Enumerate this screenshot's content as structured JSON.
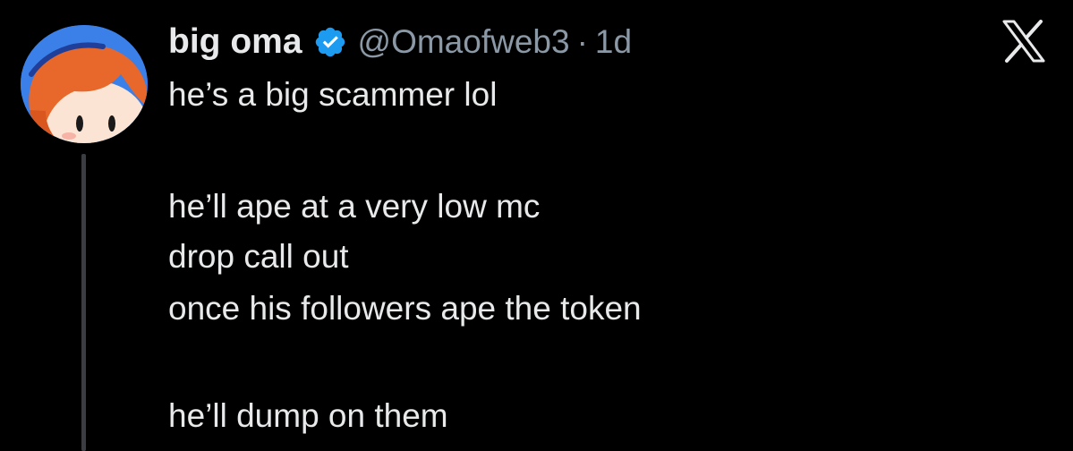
{
  "tweet": {
    "display_name": "big oma",
    "handle": "@Omaofweb3",
    "separator": "·",
    "time": "1d",
    "lines": [
      "he’s a big scammer lol",
      "he’ll ape at a very low mc",
      "drop call out",
      "once his followers ape the token",
      "he’ll dump on them"
    ]
  },
  "icons": {
    "verified": "verified-badge-icon",
    "brand": "x-logo-icon"
  },
  "colors": {
    "background": "#000000",
    "text": "#e7e9ea",
    "muted": "#8b98a5",
    "verified": "#1d9bf0",
    "avatar_bg": "#3b7fe8"
  }
}
